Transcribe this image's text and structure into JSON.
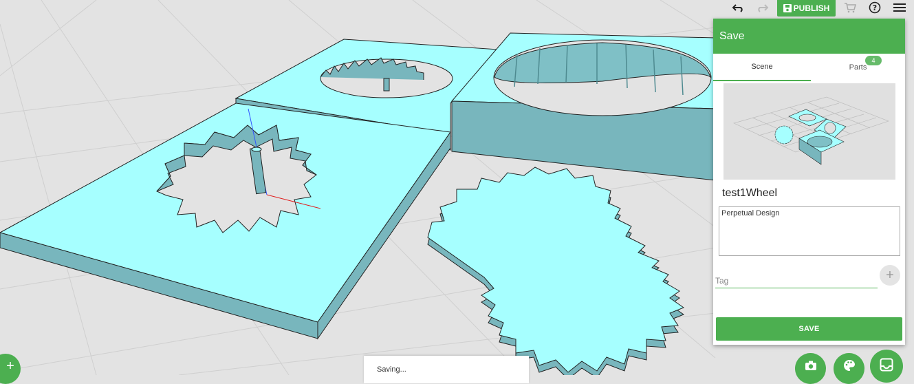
{
  "toolbar": {
    "undo_icon": "undo-icon",
    "redo_icon": "redo-icon",
    "publish_label": "PUBLISH",
    "cart_icon": "cart-icon",
    "help_icon": "help-icon",
    "menu_icon": "menu-icon"
  },
  "save_panel": {
    "title": "Save",
    "tabs": [
      {
        "label": "Scene",
        "active": true
      },
      {
        "label": "Parts",
        "badge": "4"
      }
    ],
    "design_name": "test1Wheel",
    "description": "Perpetual Design",
    "tag_placeholder": "Tag",
    "save_button_label": "SAVE"
  },
  "status": {
    "toast_text": "Saving..."
  },
  "colors": {
    "accent": "#4caf50",
    "model_top": "#a6ffff",
    "model_side": "#78b6bd",
    "floor": "#e3e3e3"
  }
}
